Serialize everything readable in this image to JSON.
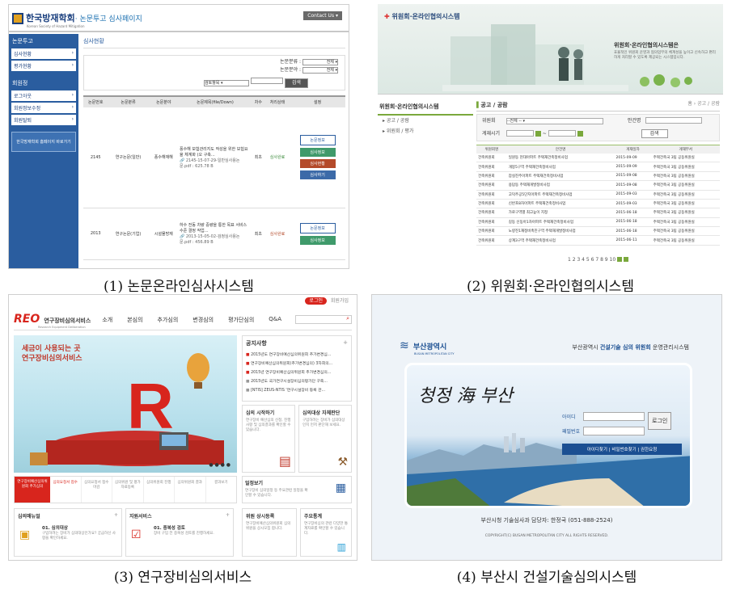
{
  "captions": {
    "c1": "(1) 논문온라인심사시스템",
    "c2": "(2) 위원회·온라인협의시스템",
    "c3": "(3) 연구장비심의서비스",
    "c4": "(4) 부산시 건설기술심의시스템"
  },
  "p1": {
    "logo": "한국방재학회",
    "logo_sub": "· 논문투고 심사페이지",
    "logo_tag": "Korean Society of Hazard Mitigation",
    "contact": "Contact Us",
    "sidebar": {
      "head1": "논문투고",
      "items1": [
        "심사현황",
        "평가현황"
      ],
      "head2": "회원정",
      "items2": [
        "로그아웃",
        "회원정보수정",
        "회원탈퇴"
      ],
      "button": "한국방재학회 홈페이지 바로가기"
    },
    "page_title": "심사현황",
    "filters": {
      "label1": "논문분류 :",
      "val1": "전체",
      "label2": "논문분야 :",
      "val2": "전체",
      "search_type": "검토항목",
      "search_btn": "검색"
    },
    "columns": [
      "논문번호",
      "논문분류",
      "논문분야",
      "논문제목(file/Down)",
      "차수",
      "처리상태",
      "설정"
    ],
    "rows": [
      {
        "no": "2145",
        "cls": "연구논문(일반)",
        "field": "풍수해재해",
        "title": "풍수해 보험관리지도 작성을 위한 보험요율 체계화 (오 구축...",
        "file": "2145-15-07-29-일반심사용논문.pdf : 625.78 B",
        "round": "최초",
        "status": "심사완료",
        "btns": [
          "논문정보",
          "심사정보",
          "심사현황",
          "심사하기"
        ]
      },
      {
        "no": "2013",
        "cls": "연구논문(기업)",
        "field": "시설물방재",
        "title": "하수 전동 차량 중량을 통한 목표 서비스 수준 결정 작업...",
        "file": "2013-15-05-02-검정심사용논문.pdf : 456.89 B",
        "round": "최초",
        "status": "심사완료",
        "btns": [
          "논문정보",
          "심사정보"
        ]
      }
    ]
  },
  "p2": {
    "logo": "위원회·온라인협의시스템",
    "banner_title": "위원회·온라인협의시스템은",
    "banner_text": "효율적인 위원회 운영과 협의업무의 체계성을 높이고 신속하고 편리하게 처리할 수 있도록 제공되는 시스템입니다.",
    "side_title": "위원회·온라인협의시스템",
    "side_items": [
      "공고 / 공람",
      "위원회 / 평가"
    ],
    "section": "공고 / 공람",
    "breadcrumb": "홈 › 공고 / 공람",
    "form": {
      "label1": "위원회",
      "val1": "--전체 --",
      "label2": "안건명",
      "label3": "게재시기",
      "search": "검색"
    },
    "columns": [
      "위원회명",
      "안건명",
      "게재일자",
      "게재부서"
    ],
    "rows": [
      [
        "건축위원회",
        "일원동 현대아파트 주택재건축정비사업",
        "2015-09-09",
        "주택건축국 3팀 공동위원실"
      ],
      [
        "건축위원회",
        "개봉5구역 주택재건축정비사업",
        "2015-09-09",
        "주택건축국 3팀 공동위원실"
      ],
      [
        "건축위원회",
        "잠실진주아파트 주택재건축정비사업",
        "2015-09-08",
        "주택건축국 3팀 공동위원실"
      ],
      [
        "건축위원회",
        "용답동 주택재개발정비사업",
        "2015-09-08",
        "주택건축국 3팀 공동위원실"
      ],
      [
        "건축위원회",
        "고덕주공5단지아파트 주택재건축정비사업",
        "2015-09-03",
        "주택건축국 3팀 공동위원실"
      ],
      [
        "건축위원회",
        "신반포8차아파트 주택재건축정비사업",
        "2015-09-03",
        "주택건축국 3팀 공동위원실"
      ],
      [
        "건축위원회",
        "가로구역별 최고높이 지정",
        "2015-06-18",
        "주택건축국 3팀 공동위원실"
      ],
      [
        "건축위원회",
        "길동 신동아1차아파트 주택재건축정비사업",
        "2015-06-18",
        "주택건축국 3팀 공동위원실"
      ],
      [
        "건축위원회",
        "노량진1재정비촉진구역 주택재개발정비사업",
        "2015-06-18",
        "주택건축국 3팀 공동위원실"
      ],
      [
        "건축위원회",
        "상계3구역 주택재건축정비사업",
        "2015-06-11",
        "주택건축국 3팀 공동위원실"
      ]
    ],
    "pages": "1 2 3 4 5 6 7 8 9 10"
  },
  "p3": {
    "login": "로그인",
    "join": "회원가입",
    "logo": "REO",
    "logo_text": "연구장비심의서비스",
    "logo_sub": "Research Equipment Deliberation",
    "nav": [
      "소개",
      "본심의",
      "추가심의",
      "변경심의",
      "평가단심의",
      "Q&A"
    ],
    "hero": "세금이 사용되는 곳 연구장비심의서비스",
    "notice_title": "공지사항",
    "notices": [
      "2015년도 연구장비예산심의위원회 추가변경심...",
      "연구장비예산심의위원회(추가변경심의) 3차회의...",
      "2015년 연구장비예산심의위원회 추가변경심의...",
      "2015년도 국가연구시설장비심의평가단 구축...",
      "[NTIS] ZEUS-NTIS '연구시설장비 등록 관..."
    ],
    "box1_title": "심의 시작하기",
    "box1_text": "연구장비 예산심의 신청, 진행사항 및 심의결과를 확인할 수 있습니다.",
    "box2_title": "심의대상 자체판단",
    "box2_text": "구입하려는 장비가 심의대상인지 먼저 판단해 보세요.",
    "tabs": [
      "연구장비예산심의위원회 추가심의",
      "심의요청서 접수",
      "심의요청서 접수 마감",
      "심의위원 및 평가 자료등록",
      "심의위원회 진행",
      "심의위원회 결과",
      "결과보기"
    ],
    "schedule_title": "일정보기",
    "schedule_text": "연구장비 심의일정 등 주요관련 일정을 확인할 수 있습니다.",
    "manual_title": "심의매뉴얼",
    "manual_item": "01. 심의대상",
    "manual_text": "구입하려는 장비가 심의대상인가요? 궁금하신 사항을 확인하세요.",
    "support_title": "지원서비스",
    "support_item": "01. 중복성 검토",
    "support_text": "장비 구입 전 중복성 검토를 진행하세요.",
    "reg_title": "위원 상시등록",
    "reg_text": "연구장비예산심의위원회 심의위원을 상시모집 합니다.",
    "stat_title": "주요통계",
    "stat_text": "연구장비심의 관련 다양한 통계자료를 확인할 수 있습니다."
  },
  "p4": {
    "logo": "부산광역시",
    "logo_sub": "BUSAN METROPOLITAN CITY",
    "title_prefix": "부산광역시 ",
    "title_em": "건설기술 심의 위원회",
    "title_suffix": " 운영관리시스템",
    "slogan": "청정 海 부산",
    "id_label": "아이디",
    "pw_label": "패밀번호",
    "login_btn": "로그인",
    "links": "아이디찾기 | 비밀번호찾기 | 권한요청",
    "contact": "부산시청 기술심사과 담당자: 한정국 (051-888-2524)",
    "copyright": "COPYRIGHT(C) BUSAN METROPOLITAN CITY ALL RIGHTS RESERVED."
  },
  "colors": {
    "p1_blue": "#2a5d9f",
    "p2_green": "#7aa83c",
    "p3_red": "#d8251d",
    "p4_blue": "#1b4f92"
  }
}
